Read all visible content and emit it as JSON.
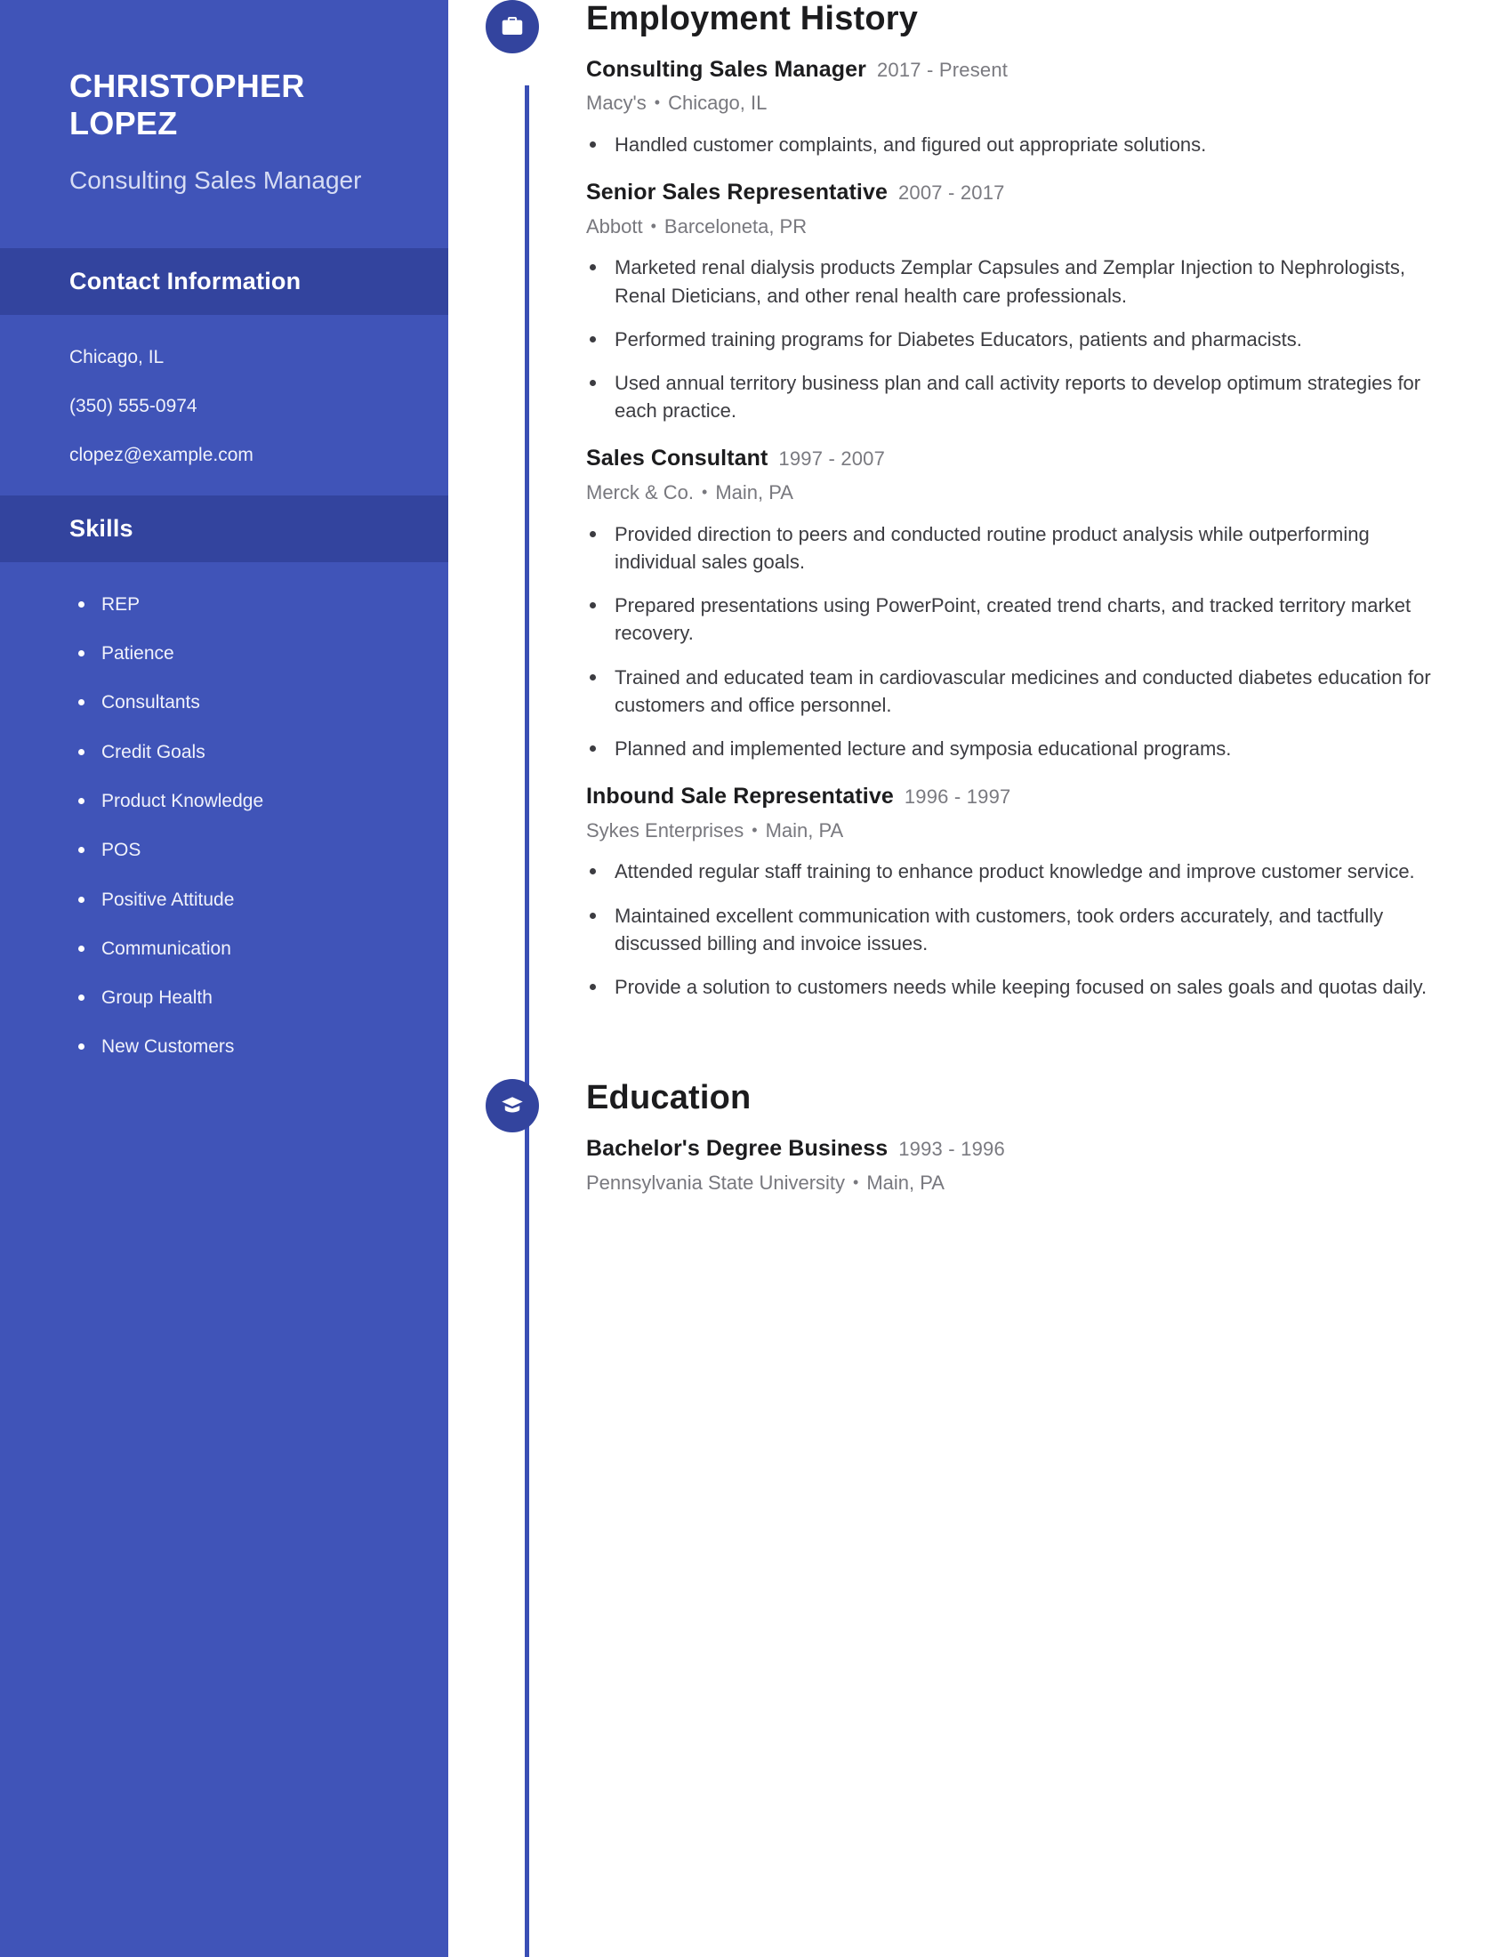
{
  "sidebar": {
    "name": "CHRISTOPHER LOPEZ",
    "role": "Consulting Sales Manager",
    "contact_heading": "Contact Information",
    "contact": [
      "Chicago, IL",
      "(350) 555-0974",
      "clopez@example.com"
    ],
    "skills_heading": "Skills",
    "skills": [
      "REP",
      "Patience",
      "Consultants",
      "Credit Goals",
      "Product Knowledge",
      "POS",
      "Positive Attitude",
      "Communication",
      "Group Health",
      "New Customers"
    ]
  },
  "colors": {
    "sidebar_bg": "#4054b8",
    "band_bg": "#33449e",
    "rail": "#3a4fb5",
    "icon_bg": "#33449e",
    "heading_text": "#1c1c1e",
    "muted_text": "#78787e"
  },
  "employment": {
    "heading": "Employment History",
    "icon": "briefcase-icon",
    "entries": [
      {
        "title": "Consulting Sales Manager",
        "dates": "2017 - Present",
        "company": "Macy's",
        "location": "Chicago, IL",
        "bullets": [
          "Handled customer complaints, and figured out appropriate solutions."
        ]
      },
      {
        "title": "Senior Sales Representative",
        "dates": "2007 - 2017",
        "company": "Abbott",
        "location": "Barceloneta, PR",
        "bullets": [
          "Marketed renal dialysis products Zemplar Capsules and Zemplar Injection to Nephrologists, Renal Dieticians, and other renal health care professionals.",
          "Performed training programs for Diabetes Educators, patients and pharmacists.",
          "Used annual territory business plan and call activity reports to develop optimum strategies for each practice."
        ]
      },
      {
        "title": "Sales Consultant",
        "dates": "1997 - 2007",
        "company": "Merck & Co.",
        "location": "Main, PA",
        "bullets": [
          "Provided direction to peers and conducted routine product analysis while outperforming individual sales goals.",
          "Prepared presentations using PowerPoint, created trend charts, and tracked territory market recovery.",
          "Trained and educated team in cardiovascular medicines and conducted diabetes education for customers and office personnel.",
          "Planned and implemented lecture and symposia educational programs."
        ]
      },
      {
        "title": "Inbound Sale Representative",
        "dates": "1996 - 1997",
        "company": "Sykes Enterprises",
        "location": "Main, PA",
        "bullets": [
          "Attended regular staff training to enhance product knowledge and improve customer service.",
          "Maintained excellent communication with customers, took orders accurately, and tactfully discussed billing and invoice issues.",
          "Provide a solution to customers needs while keeping focused on sales goals and quotas daily."
        ]
      }
    ]
  },
  "education": {
    "heading": "Education",
    "icon": "graduation-cap-icon",
    "entries": [
      {
        "title": "Bachelor's Degree Business",
        "dates": "1993 - 1996",
        "school": "Pennsylvania State University",
        "location": "Main, PA"
      }
    ]
  }
}
